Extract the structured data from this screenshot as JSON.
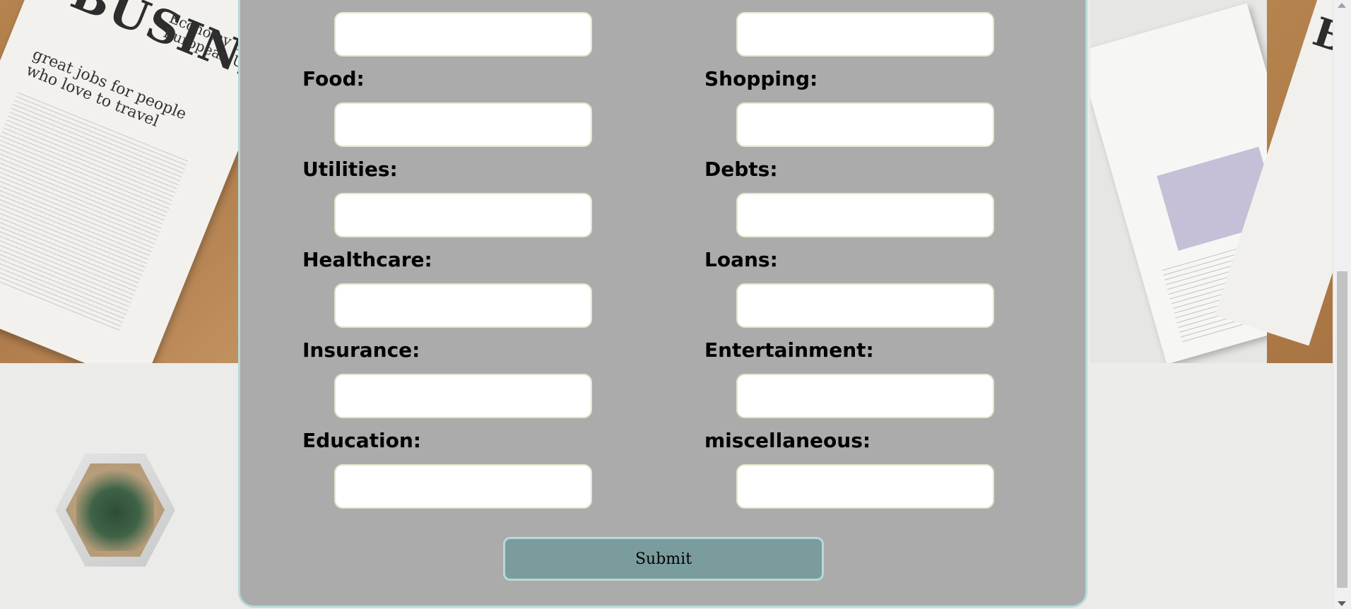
{
  "form": {
    "left_column": [
      {
        "label": "",
        "value": ""
      },
      {
        "label": "Food:",
        "value": ""
      },
      {
        "label": "Utilities:",
        "value": ""
      },
      {
        "label": "Healthcare:",
        "value": ""
      },
      {
        "label": "Insurance:",
        "value": ""
      },
      {
        "label": "Education:",
        "value": ""
      }
    ],
    "right_column": [
      {
        "label": "",
        "value": ""
      },
      {
        "label": "Shopping:",
        "value": ""
      },
      {
        "label": "Debts:",
        "value": ""
      },
      {
        "label": "Loans:",
        "value": ""
      },
      {
        "label": "Entertainment:",
        "value": ""
      },
      {
        "label": "miscellaneous:",
        "value": ""
      }
    ],
    "submit_label": "Submit"
  },
  "background": {
    "newspaper_masthead": "BUSINESS",
    "newspaper_headline": "great jobs for people who love to travel",
    "newspaper_side_headline": "Economy of European U"
  },
  "colors": {
    "panel_bg": "#ababab",
    "panel_border": "#b7d9d6",
    "button_bg": "#7a9c9c",
    "input_border": "#e4e6c9"
  }
}
